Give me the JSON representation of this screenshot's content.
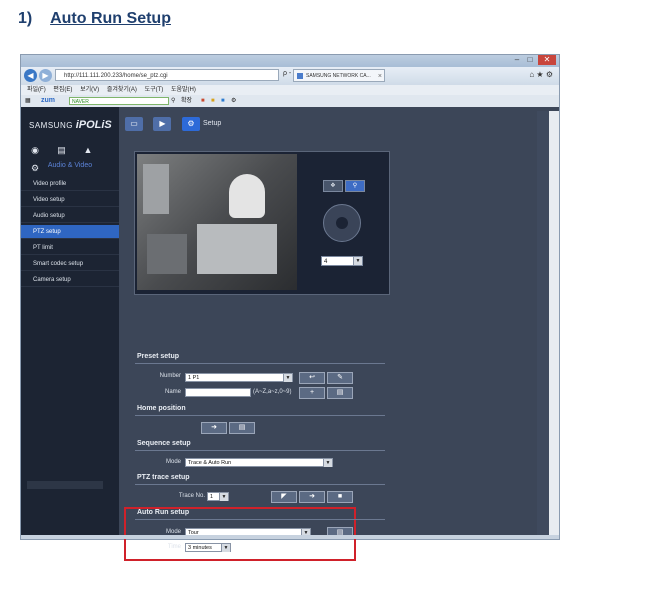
{
  "doc": {
    "number": "1)",
    "title": "Auto Run Setup"
  },
  "browser": {
    "url": "http://111.111.200.233/home/se_ptz.cgi",
    "url_controls": "ρ - C X",
    "tab_title": "SAMSUNG NETWORK CA...",
    "menu": [
      "파일(F)",
      "편집(E)",
      "보기(V)",
      "즐겨찾기(A)",
      "도구(T)",
      "도움말(H)"
    ],
    "toolbar_brand": "zum",
    "search_engine": "NAVER",
    "toolbar_extra": "확장"
  },
  "viewer": {
    "brand": "SAMSUNG",
    "product": "iPOLiS",
    "main_tab_setup": "Setup",
    "section_head": "Audio & Video",
    "menu_items": [
      "Video profile",
      "Video setup",
      "Audio setup",
      "PTZ setup",
      "PT limit",
      "Smart codec setup",
      "Camera setup"
    ],
    "active_menu": "PTZ setup",
    "speed_value": "4",
    "preset": {
      "title": "Preset setup",
      "number_label": "Number",
      "number_value": "1 P1",
      "name_label": "Name",
      "name_value": "",
      "name_hint": "(A~Z,a~z,0~9)"
    },
    "home": {
      "title": "Home position"
    },
    "sequence": {
      "title": "Sequence setup",
      "mode_label": "Mode",
      "mode_value": "Trace & Auto Run"
    },
    "trace": {
      "title": "PTZ trace setup",
      "trace_label": "Trace No.",
      "trace_value": "1"
    },
    "auto_run": {
      "title": "Auto Run setup",
      "mode_label": "Mode",
      "mode_value": "Tour",
      "time_label": "Time",
      "time_value": "3 minutes"
    }
  },
  "colors": {
    "highlight": "#d0212a",
    "accent": "#2f66c2",
    "heading": "#1f3f6e"
  }
}
